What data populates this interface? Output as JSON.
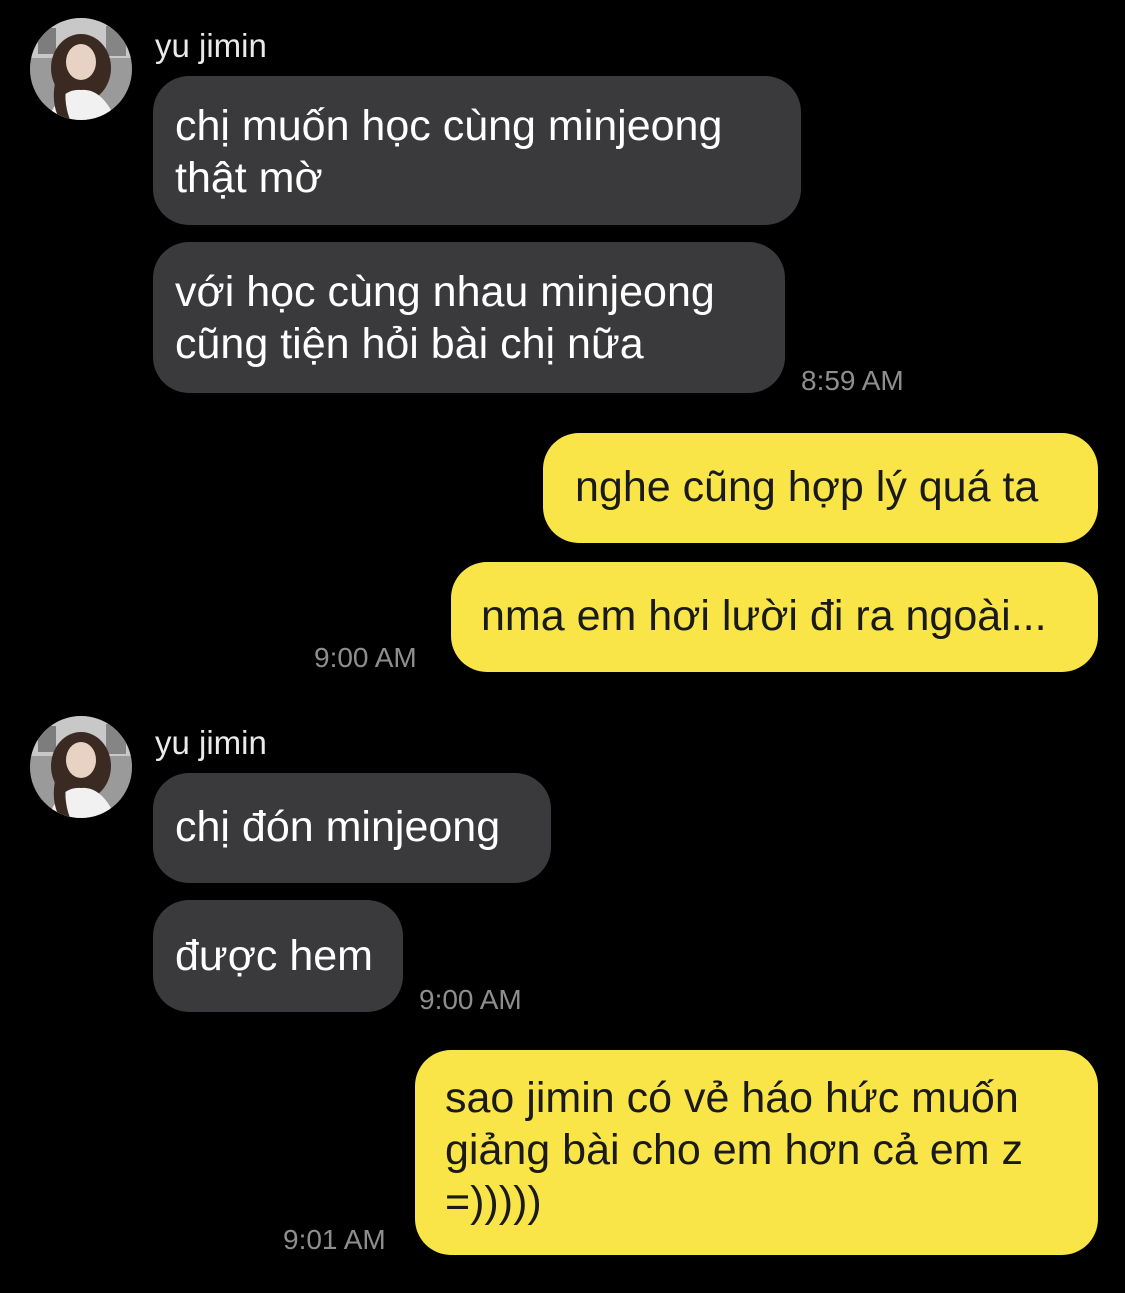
{
  "colors": {
    "background": "#000000",
    "incoming_bubble": "#3a3a3c",
    "outgoing_bubble": "#f9e547",
    "timestamp": "#8e8e8e"
  },
  "groups": [
    {
      "sender": "yu jimin",
      "avatar_icon": "profile-photo",
      "messages": [
        "chị muốn học cùng minjeong\nthật mờ",
        "với học cùng nhau minjeong\ncũng tiện hỏi bài chị nữa"
      ],
      "time": "8:59 AM"
    },
    {
      "sender": "me",
      "messages": [
        "nghe cũng hợp lý quá ta",
        "nma em hơi lười đi ra ngoài..."
      ],
      "time": "9:00 AM"
    },
    {
      "sender": "yu jimin",
      "avatar_icon": "profile-photo",
      "messages": [
        "chị đón minjeong",
        "được hem"
      ],
      "time": "9:00 AM"
    },
    {
      "sender": "me",
      "messages": [
        "sao jimin có vẻ háo hức muốn\ngiảng bài cho em hơn cả em z\n=)))))"
      ],
      "time": "9:01 AM"
    }
  ]
}
